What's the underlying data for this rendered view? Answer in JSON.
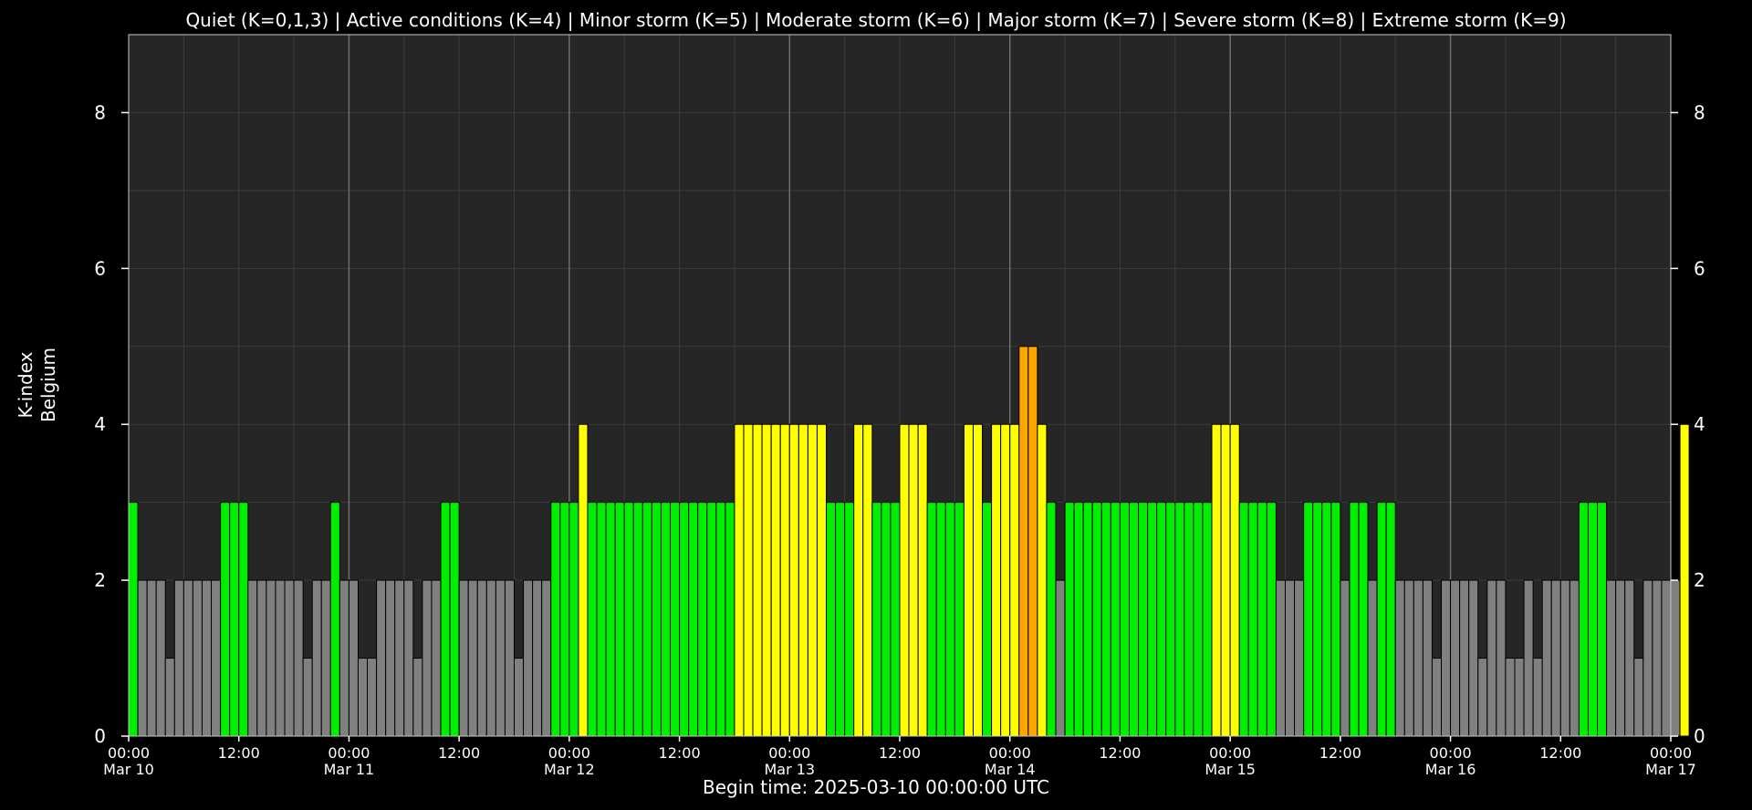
{
  "chart_data": {
    "type": "bar",
    "title": "Quiet (K=0,1,3) | Active conditions (K=4) | Minor storm (K=5) | Moderate storm (K=6) | Major storm (K=7) | Severe storm (K=8) | Extreme storm (K=9)",
    "ylabel_line1": "K-index",
    "ylabel_line2": "Belgium",
    "xlabel": "Begin time: 2025-03-10 00:00:00 UTC",
    "ylim": [
      0,
      9
    ],
    "yticks": [
      0,
      2,
      4,
      6,
      8
    ],
    "x_range_hours": [
      0,
      168
    ],
    "bar_interval_hours": 1,
    "x_tick_labels": [
      {
        "hour": 0,
        "time": "00:00",
        "date": "Mar 10"
      },
      {
        "hour": 12,
        "time": "12:00",
        "date": ""
      },
      {
        "hour": 24,
        "time": "00:00",
        "date": "Mar 11"
      },
      {
        "hour": 36,
        "time": "12:00",
        "date": ""
      },
      {
        "hour": 48,
        "time": "00:00",
        "date": "Mar 12"
      },
      {
        "hour": 60,
        "time": "12:00",
        "date": ""
      },
      {
        "hour": 72,
        "time": "00:00",
        "date": "Mar 13"
      },
      {
        "hour": 84,
        "time": "12:00",
        "date": ""
      },
      {
        "hour": 96,
        "time": "00:00",
        "date": "Mar 14"
      },
      {
        "hour": 108,
        "time": "12:00",
        "date": ""
      },
      {
        "hour": 120,
        "time": "00:00",
        "date": "Mar 15"
      },
      {
        "hour": 132,
        "time": "12:00",
        "date": ""
      },
      {
        "hour": 144,
        "time": "00:00",
        "date": "Mar 16"
      },
      {
        "hour": 156,
        "time": "12:00",
        "date": ""
      },
      {
        "hour": 168,
        "time": "00:00",
        "date": "Mar 17"
      }
    ],
    "colors": {
      "k0_2": "#808080",
      "k3": "#00ee00",
      "k4": "#ffff00",
      "k5": "#ffa500",
      "plot_bg": "#262626",
      "page_bg": "#000000"
    },
    "values": [
      3,
      2,
      2,
      2,
      1,
      2,
      2,
      2,
      2,
      2,
      3,
      3,
      3,
      2,
      2,
      2,
      2,
      2,
      2,
      1,
      2,
      2,
      3,
      2,
      2,
      1,
      1,
      2,
      2,
      2,
      2,
      1,
      2,
      2,
      3,
      3,
      2,
      2,
      2,
      2,
      2,
      2,
      1,
      2,
      2,
      2,
      3,
      3,
      3,
      4,
      3,
      3,
      3,
      3,
      3,
      3,
      3,
      3,
      3,
      3,
      3,
      3,
      3,
      3,
      3,
      3,
      4,
      4,
      4,
      4,
      4,
      4,
      4,
      4,
      4,
      4,
      3,
      3,
      3,
      4,
      4,
      3,
      3,
      3,
      4,
      4,
      4,
      3,
      3,
      3,
      3,
      4,
      4,
      3,
      4,
      4,
      4,
      5,
      5,
      4,
      3,
      2,
      3,
      3,
      3,
      3,
      3,
      3,
      3,
      3,
      3,
      3,
      3,
      3,
      3,
      3,
      3,
      3,
      4,
      4,
      4,
      3,
      3,
      3,
      3,
      2,
      2,
      2,
      3,
      3,
      3,
      3,
      2,
      3,
      3,
      2,
      3,
      3,
      2,
      2,
      2,
      2,
      1,
      2,
      2,
      2,
      2,
      1,
      2,
      2,
      1,
      1,
      2,
      1,
      2,
      2,
      2,
      2,
      3,
      3,
      3,
      2,
      2,
      2,
      1,
      2,
      2,
      2,
      2,
      4
    ]
  }
}
